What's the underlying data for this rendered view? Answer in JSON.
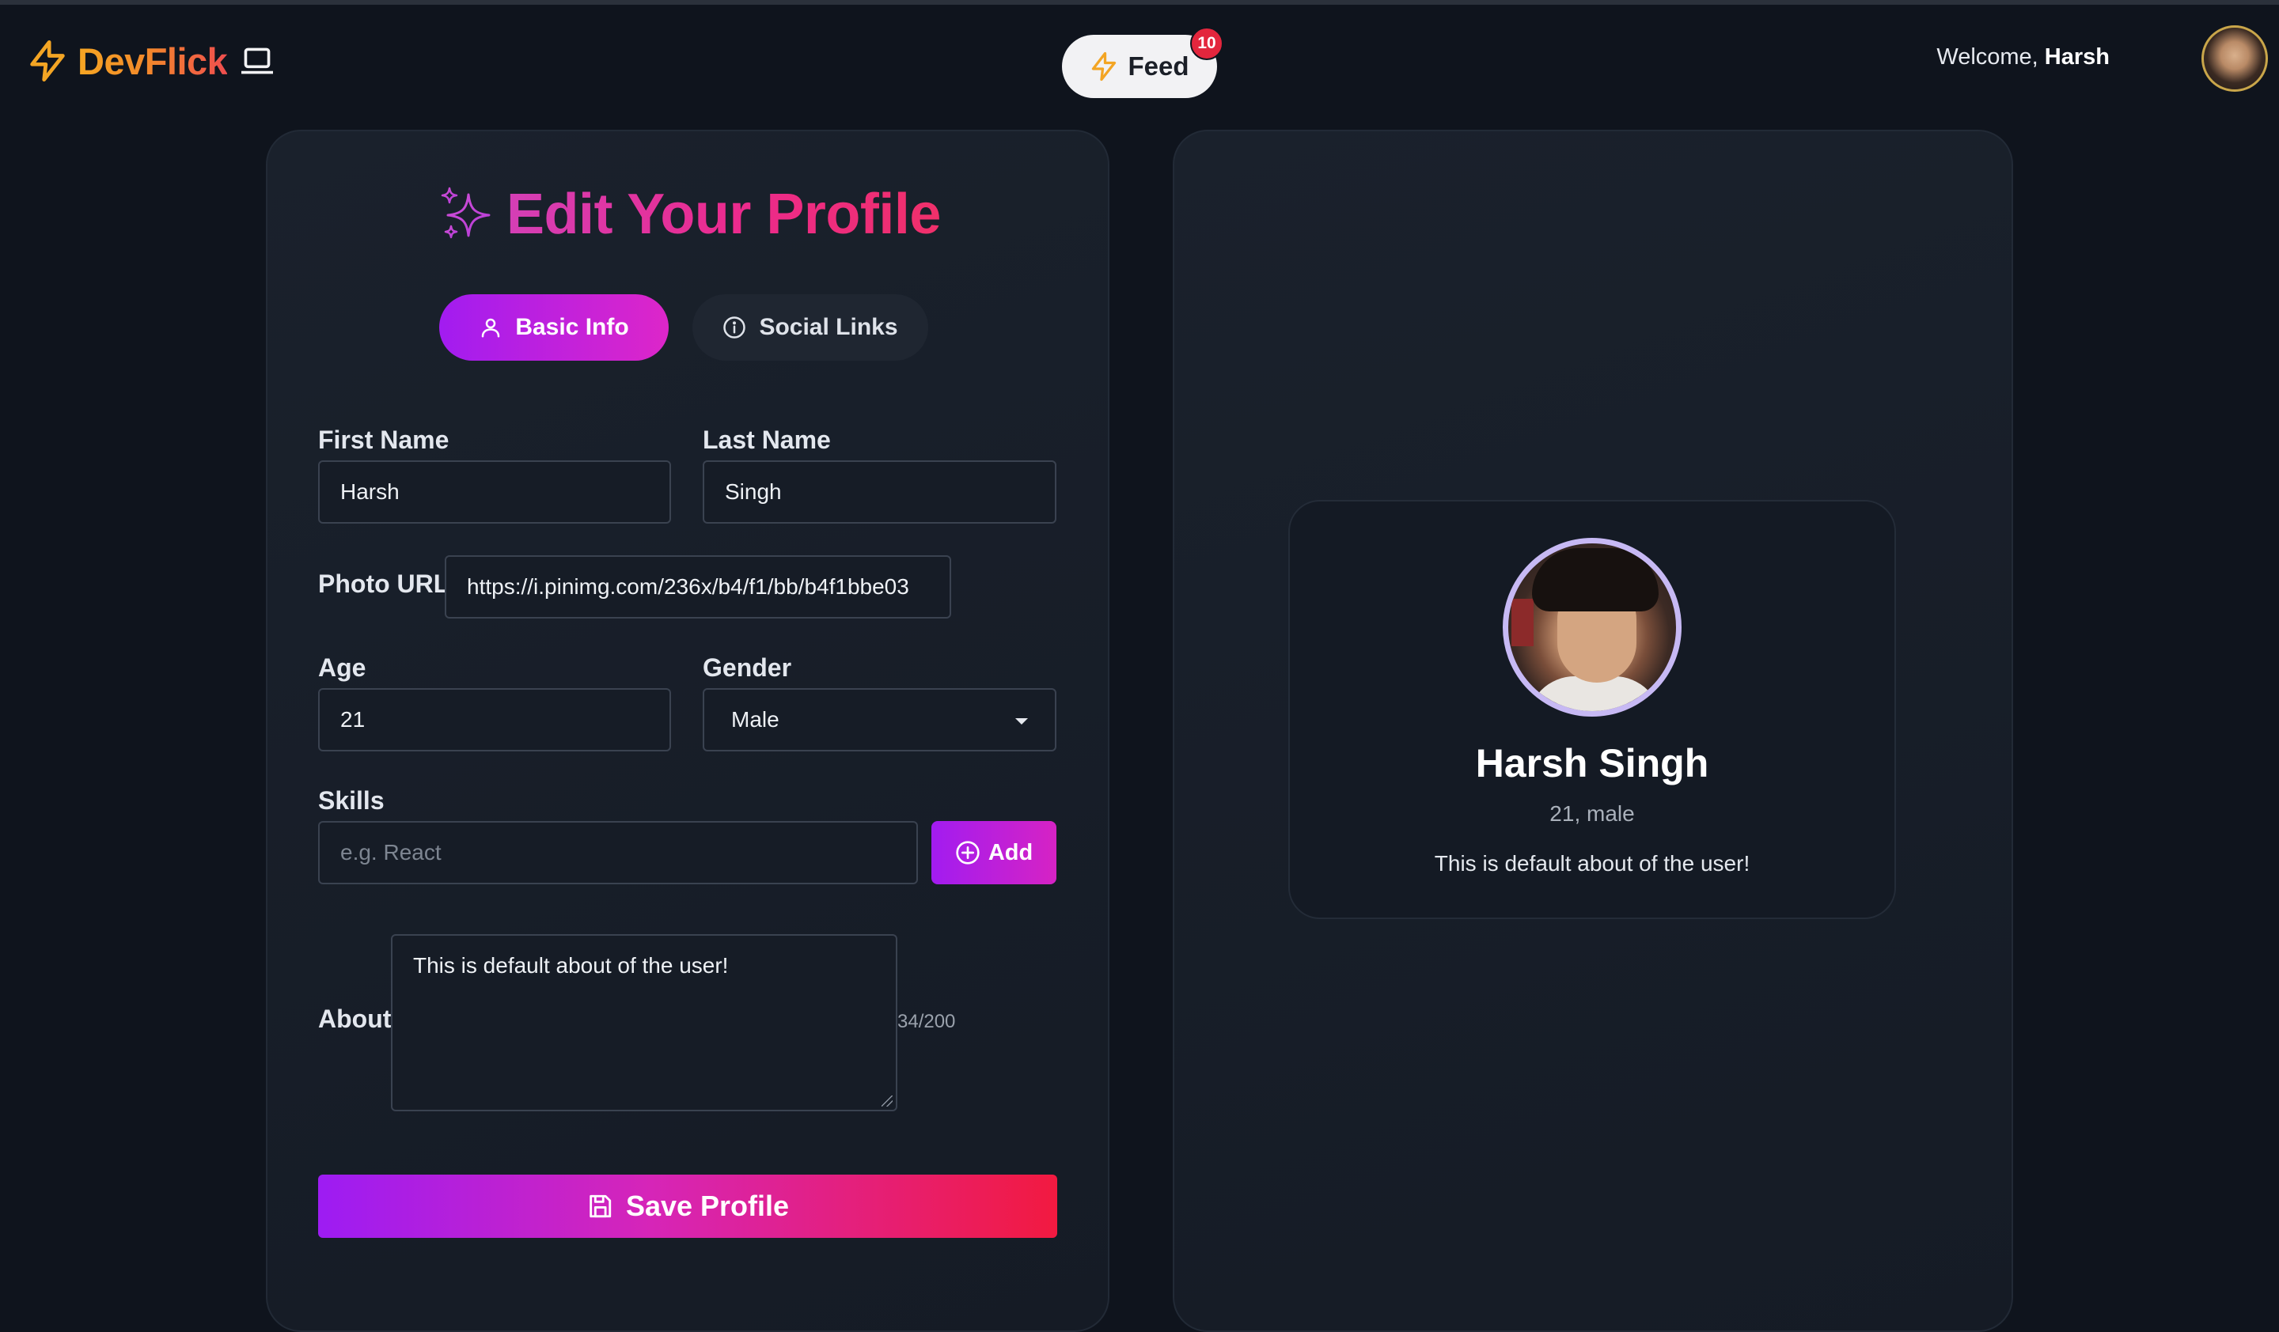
{
  "navbar": {
    "brand": "DevFlick",
    "feed_label": "Feed",
    "feed_badge": "10",
    "welcome_prefix": "Welcome,",
    "welcome_name": "Harsh"
  },
  "form": {
    "title": "Edit Your Profile",
    "tabs": [
      {
        "label": "Basic Info",
        "active": true
      },
      {
        "label": "Social Links",
        "active": false
      }
    ],
    "first_name": {
      "label": "First Name",
      "value": "Harsh"
    },
    "last_name": {
      "label": "Last Name",
      "value": "Singh"
    },
    "photo_url": {
      "label": "Photo URL",
      "value": "https://i.pinimg.com/236x/b4/f1/bb/b4f1bbe03"
    },
    "age": {
      "label": "Age",
      "value": "21"
    },
    "gender": {
      "label": "Gender",
      "value": "Male"
    },
    "skills": {
      "label": "Skills",
      "placeholder": "e.g. React",
      "add_label": "Add"
    },
    "about": {
      "label": "About",
      "value": "This is default about of the user!",
      "counter": "34/200"
    },
    "save_label": "Save Profile"
  },
  "preview": {
    "name": "Harsh Singh",
    "meta": "21, male",
    "about": "This is default about of the user!"
  },
  "colors": {
    "background": "#0f141d",
    "accent_purple": "#a21cf0",
    "accent_pink": "#ec2a8c",
    "accent_red": "#f21a40",
    "brand_orange": "#f6a623",
    "badge_red": "#e3263d"
  }
}
